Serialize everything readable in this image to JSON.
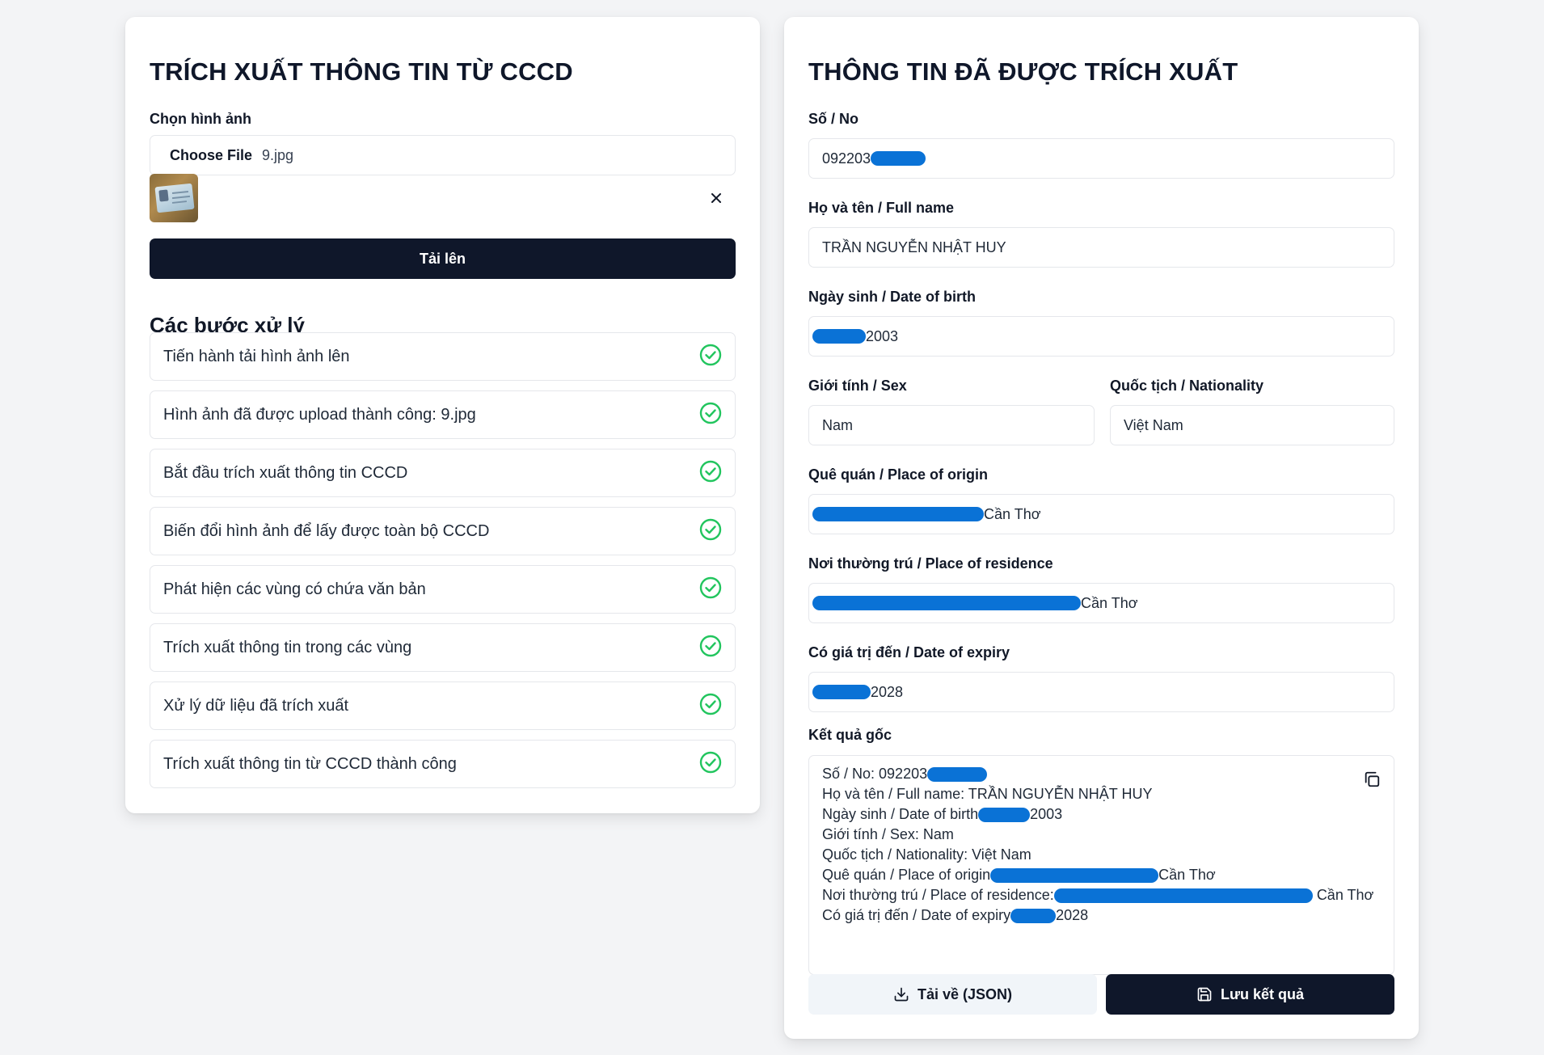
{
  "left": {
    "title": "TRÍCH XUẤT THÔNG TIN TỪ CCCD",
    "choose_label": "Chọn hình ảnh",
    "choose_button": "Choose File",
    "file_name": "9.jpg",
    "upload_button": "Tải lên",
    "steps_title": "Các bước xử lý",
    "steps": [
      {
        "label": "Tiến hành tải hình ảnh lên",
        "status": "done"
      },
      {
        "label": "Hình ảnh đã được upload thành công: 9.jpg",
        "status": "done"
      },
      {
        "label": "Bắt đầu trích xuất thông tin CCCD",
        "status": "done"
      },
      {
        "label": "Biến đổi hình ảnh để lấy được toàn bộ CCCD",
        "status": "done"
      },
      {
        "label": "Phát hiện các vùng có chứa văn bản",
        "status": "done"
      },
      {
        "label": "Trích xuất thông tin trong các vùng",
        "status": "done"
      },
      {
        "label": "Xử lý dữ liệu đã trích xuất",
        "status": "done"
      },
      {
        "label": "Trích xuất thông tin từ CCCD thành công",
        "status": "done"
      }
    ]
  },
  "right": {
    "title": "THÔNG TIN ĐÃ ĐƯỢC TRÍCH XUẤT",
    "fields": {
      "no": {
        "label": "Số / No",
        "value_visible": "092203"
      },
      "full_name": {
        "label": "Họ và tên / Full name",
        "value": "TRẦN NGUYỄN NHẬT HUY"
      },
      "dob": {
        "label": "Ngày sinh / Date of birth",
        "value_visible": "2003"
      },
      "sex": {
        "label": "Giới tính / Sex",
        "value": "Nam"
      },
      "nationality": {
        "label": "Quốc tịch / Nationality",
        "value": "Việt Nam"
      },
      "origin": {
        "label": "Quê quán / Place of origin",
        "value_visible": "Cần Thơ"
      },
      "residence": {
        "label": "Nơi thường trú / Place of residence",
        "value_visible": "Cần Thơ"
      },
      "expiry": {
        "label": "Có giá trị đến / Date of expiry",
        "value_visible": "2028"
      }
    },
    "raw_label": "Kết quả gốc",
    "raw_lines": {
      "l1_prefix": "Số / No: 092203",
      "l2": "Họ và tên / Full name: TRẦN NGUYỄN NHẬT HUY",
      "l3_prefix": "Ngày sinh / Date of birth",
      "l3_suffix": "2003",
      "l4": "Giới tính / Sex: Nam",
      "l5": "Quốc tịch / Nationality: Việt Nam",
      "l6_prefix": "Quê quán / Place of origin",
      "l6_suffix": "Cần Thơ",
      "l7_prefix": "Nơi thường trú / Place of residence:",
      "l7_suffix": "Cần Thơ",
      "l8_prefix": "Có giá trị đến / Date of expiry",
      "l8_suffix": "2028"
    },
    "download_button": "Tải về (JSON)",
    "save_button": "Lưu kết quả"
  },
  "colors": {
    "background": "#f3f4f6",
    "primary_dark": "#0f172a",
    "success_green": "#22c55e",
    "redaction_blue": "#0a72d6"
  },
  "icons": {
    "step_status": "check-circle-icon",
    "close": "close-icon",
    "copy": "copy-icon",
    "download": "download-icon",
    "save": "save-icon"
  }
}
